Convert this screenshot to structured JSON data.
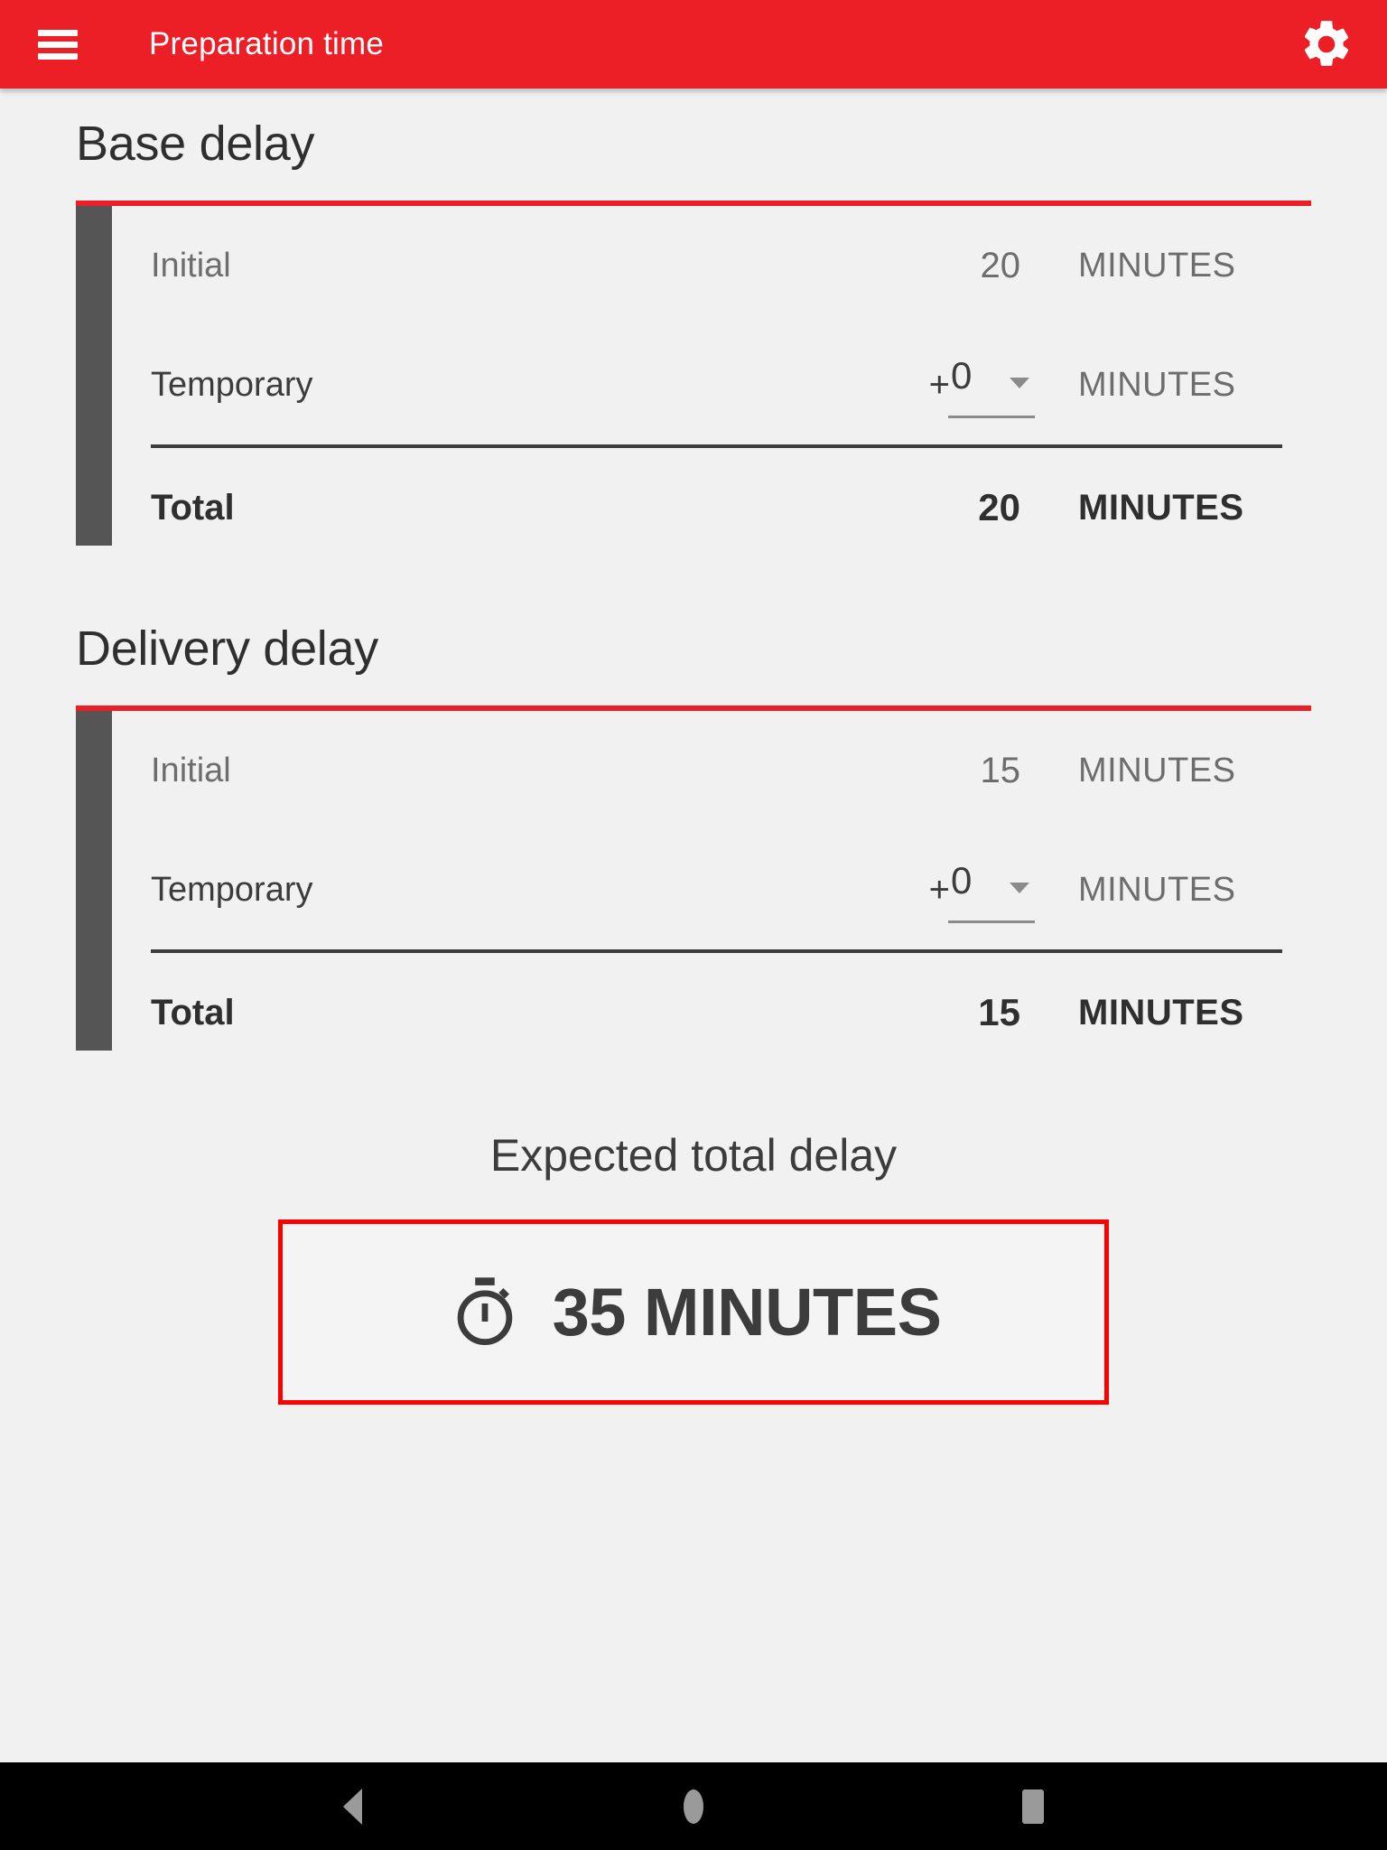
{
  "appbar": {
    "title": "Preparation time",
    "menu_icon": "hamburger-menu-icon",
    "settings_icon": "gear-icon",
    "background_color": "#EC1F26"
  },
  "sections": [
    {
      "title": "Base delay",
      "rows": [
        {
          "label": "Initial",
          "value": "20",
          "unit": "MINUTES"
        },
        {
          "label": "Temporary",
          "prefix": "+",
          "value": "0",
          "unit": "MINUTES"
        },
        {
          "label": "Total",
          "value": "20",
          "unit": "MINUTES"
        }
      ]
    },
    {
      "title": "Delivery delay",
      "rows": [
        {
          "label": "Initial",
          "value": "15",
          "unit": "MINUTES"
        },
        {
          "label": "Temporary",
          "prefix": "+",
          "value": "0",
          "unit": "MINUTES"
        },
        {
          "label": "Total",
          "value": "15",
          "unit": "MINUTES"
        }
      ]
    }
  ],
  "expected": {
    "title": "Expected total delay",
    "icon": "stopwatch-icon",
    "value": "35 MINUTES",
    "border_color": "#FF0000"
  },
  "sysnav": {
    "back": "back-triangle-icon",
    "home": "home-circle-icon",
    "recents": "recents-square-icon"
  }
}
